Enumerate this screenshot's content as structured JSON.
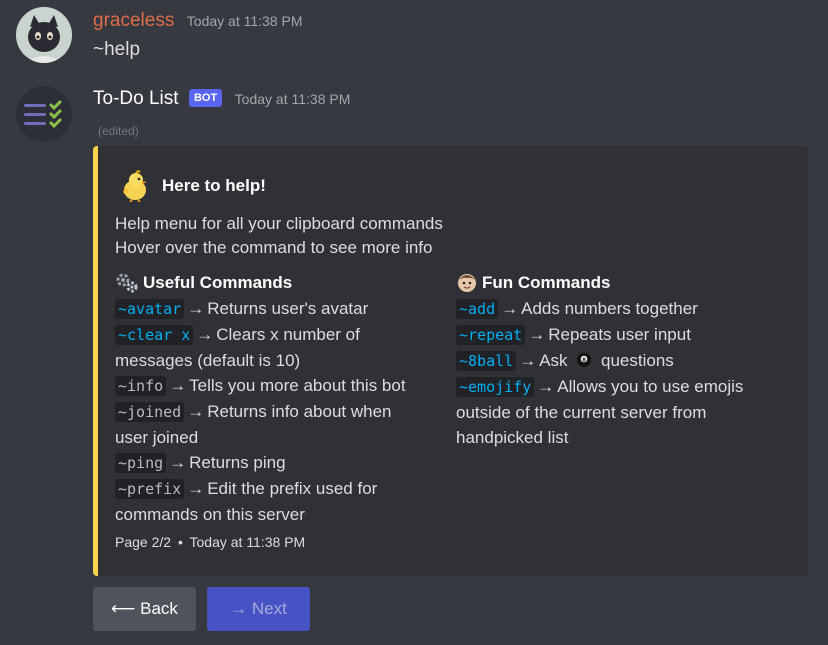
{
  "message1": {
    "username": "graceless",
    "username_color": "#e06c4a",
    "timestamp": "Today at 11:38 PM",
    "content": "~help"
  },
  "message2": {
    "username": "To-Do List",
    "bot_tag": "BOT",
    "timestamp": "Today at 11:38 PM",
    "edited": "(edited)",
    "embed": {
      "accent_color": "#fcd34d",
      "author_icon": "chick-icon",
      "author_name": "Here to help!",
      "description_line1": "Help menu for all your clipboard commands",
      "description_line2": "Hover over the command to see more info",
      "fields": [
        {
          "icon": "gear-icon",
          "title": "Useful Commands",
          "items": [
            {
              "cmd": "~avatar",
              "desc": "Returns user's avatar"
            },
            {
              "cmd": "~clear x",
              "desc": "Clears x number of",
              "wrap": "messages (default is 10)"
            },
            {
              "cmd": "~info",
              "desc": "Tells you more about this bot"
            },
            {
              "cmd": "~joined",
              "desc": "Returns info about when",
              "wrap": "user joined"
            },
            {
              "cmd": "~ping",
              "desc": "Returns ping"
            },
            {
              "cmd": "~prefix",
              "desc": "Edit the prefix used for",
              "wrap": "commands on this server"
            }
          ]
        },
        {
          "icon": "face-icon",
          "title": "Fun Commands",
          "items": [
            {
              "cmd": "~add",
              "desc": "Adds numbers together"
            },
            {
              "cmd": "~repeat",
              "desc": "Repeats user input"
            },
            {
              "cmd": "~8ball",
              "desc": "Ask",
              "extra": "questions"
            },
            {
              "cmd": "~emojify",
              "desc": "Allows you to use emojis",
              "wrap": "outside of the current server from",
              "wrap2": "handpicked list"
            }
          ]
        }
      ],
      "footer_page": "Page 2/2",
      "footer_sep": "•",
      "footer_time": "Today at 11:38 PM"
    },
    "buttons": {
      "back": "⟵ Back",
      "next": "→ Next"
    }
  }
}
